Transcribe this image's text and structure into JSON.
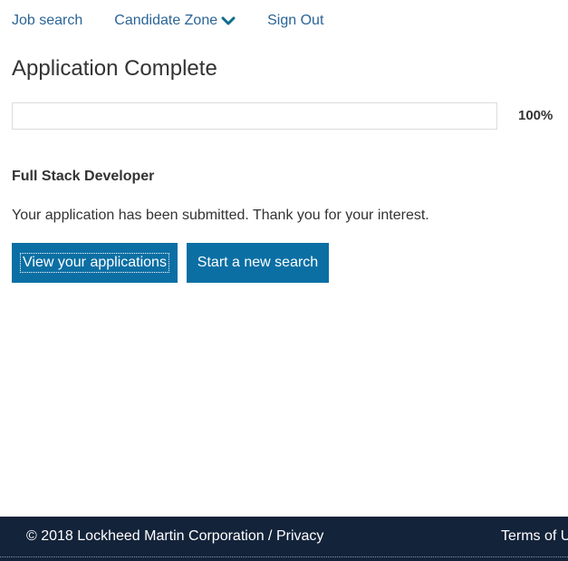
{
  "nav": {
    "job_search": "Job search",
    "candidate_zone": "Candidate Zone",
    "sign_out": "Sign Out",
    "chevron_icon": "chevron-down-icon",
    "link_color": "#2a6496"
  },
  "page_title": "Application Complete",
  "progress": {
    "value": 1.0,
    "label": "100%"
  },
  "job": {
    "title": "Full Stack Developer",
    "message": "Your application has been submitted. Thank you for your interest."
  },
  "buttons": {
    "view_applications": "View your applications",
    "new_search": "Start a new search",
    "color": "#0b6fa4"
  },
  "footer": {
    "copyright": "© 2018 Lockheed Martin Corporation / ",
    "privacy": "Privacy",
    "terms": "Terms of U",
    "background": "#13233a"
  }
}
